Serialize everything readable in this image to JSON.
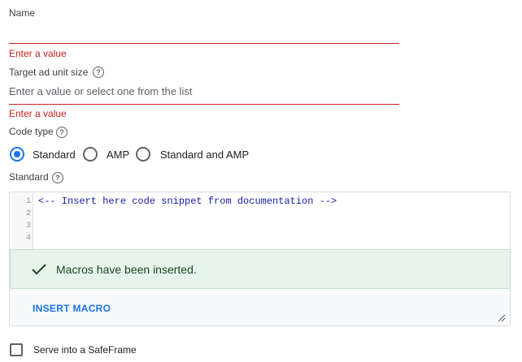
{
  "name_field": {
    "label": "Name",
    "value": "",
    "error": "Enter a value"
  },
  "target_field": {
    "label": "Target ad unit size",
    "placeholder": "Enter a value or select one from the list",
    "error": "Enter a value",
    "help_icon": "?"
  },
  "code_type": {
    "label": "Code type",
    "help_icon": "?",
    "options": [
      {
        "label": "Standard",
        "selected": true
      },
      {
        "label": "AMP",
        "selected": false
      },
      {
        "label": "Standard and AMP",
        "selected": false
      }
    ]
  },
  "standard_section": {
    "label": "Standard",
    "help_icon": "?",
    "editor": {
      "line_numbers": [
        "1",
        "2",
        "3",
        "4"
      ],
      "first_line_code": "<-- Insert here code snippet from documentation -->"
    },
    "success_message": "Macros have been inserted.",
    "insert_macro_label": "INSERT MACRO"
  },
  "safeframe": {
    "label": "Serve into a SafeFrame",
    "checked": false
  },
  "colors": {
    "accent": "#1a73e8",
    "error": "#c5221f",
    "success_bg": "#e6f4ea",
    "success_text": "#1e4620"
  }
}
